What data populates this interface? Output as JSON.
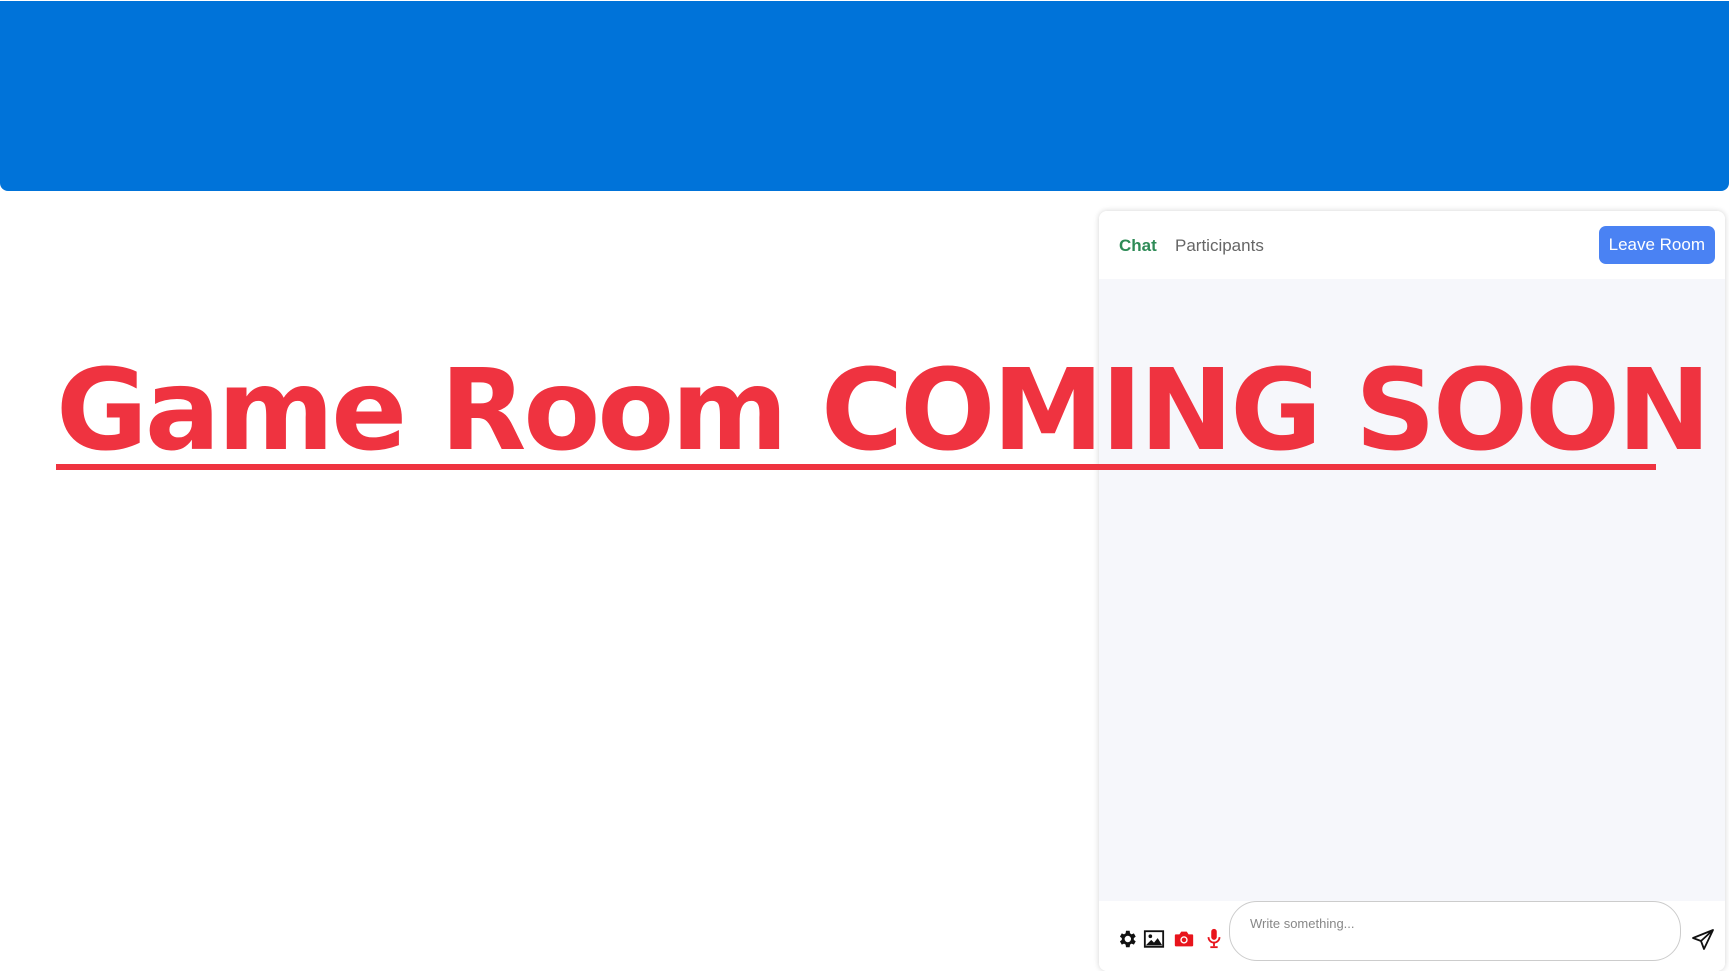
{
  "header": {
    "brand_color": "#0073d9"
  },
  "main": {
    "headline": "Game Room COMING SOON",
    "headline_color": "#ef3340"
  },
  "chat_panel": {
    "tabs": [
      {
        "label": "Chat",
        "active": true
      },
      {
        "label": "Participants",
        "active": false
      }
    ],
    "leave_button_label": "Leave Room",
    "input_placeholder": "Write something...",
    "toolbar_icons": [
      "gear-icon",
      "image-icon",
      "camera-icon",
      "microphone-icon"
    ],
    "send_icon": "send-icon",
    "accent_colors": {
      "active_tab": "#2e8b57",
      "leave_button": "#4a82f3",
      "camera_icon": "#e8141c",
      "microphone_icon": "#e8141c"
    }
  }
}
